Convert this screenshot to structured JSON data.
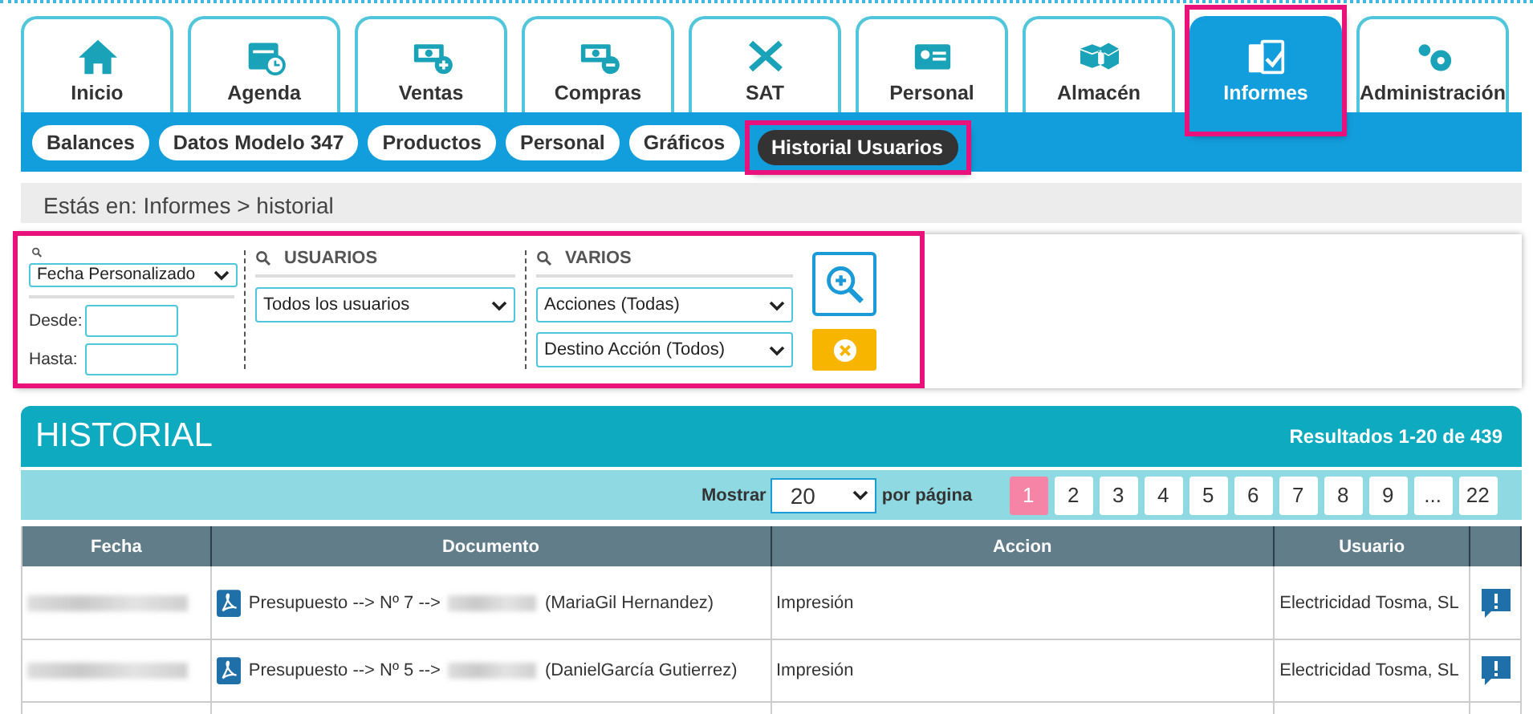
{
  "main_tabs": [
    {
      "label": "Inicio",
      "selected": false,
      "highlighted": false
    },
    {
      "label": "Agenda",
      "selected": false,
      "highlighted": false
    },
    {
      "label": "Ventas",
      "selected": false,
      "highlighted": false
    },
    {
      "label": "Compras",
      "selected": false,
      "highlighted": false
    },
    {
      "label": "SAT",
      "selected": false,
      "highlighted": false
    },
    {
      "label": "Personal",
      "selected": false,
      "highlighted": false
    },
    {
      "label": "Almacén",
      "selected": false,
      "highlighted": false
    },
    {
      "label": "Informes",
      "selected": true,
      "highlighted": true
    },
    {
      "label": "Administración",
      "selected": false,
      "highlighted": false
    }
  ],
  "sub_tabs": [
    {
      "label": "Balances",
      "selected": false,
      "highlighted": false
    },
    {
      "label": "Datos Modelo 347",
      "selected": false,
      "highlighted": false
    },
    {
      "label": "Productos",
      "selected": false,
      "highlighted": false
    },
    {
      "label": "Personal",
      "selected": false,
      "highlighted": false
    },
    {
      "label": "Gráficos",
      "selected": false,
      "highlighted": false
    },
    {
      "label": "Historial Usuarios",
      "selected": true,
      "highlighted": true
    }
  ],
  "breadcrumb": "Estás en: Informes > historial",
  "filters": {
    "highlighted": true,
    "date": {
      "select": "Fecha Personalizado",
      "from_label": "Desde:",
      "to_label": "Hasta:"
    },
    "users": {
      "heading": "USUARIOS",
      "select": "Todos los usuarios"
    },
    "misc": {
      "heading": "VARIOS",
      "selects": [
        "Acciones (Todas)",
        "Destino Acción (Todos)"
      ]
    }
  },
  "history": {
    "title": "HISTORIAL",
    "results": "Resultados 1-20 de 439",
    "show_label": "Mostrar",
    "per_page": "20",
    "per_page_label": "por página",
    "pages": [
      {
        "label": "1",
        "selected": true
      },
      {
        "label": "2",
        "selected": false
      },
      {
        "label": "3",
        "selected": false
      },
      {
        "label": "4",
        "selected": false
      },
      {
        "label": "5",
        "selected": false
      },
      {
        "label": "6",
        "selected": false
      },
      {
        "label": "7",
        "selected": false
      },
      {
        "label": "8",
        "selected": false
      },
      {
        "label": "9",
        "selected": false
      },
      {
        "label": "...",
        "selected": false
      },
      {
        "label": "22",
        "selected": false
      }
    ],
    "columns": [
      "Fecha",
      "Documento",
      "Accion",
      "Usuario"
    ],
    "rows": [
      {
        "doc_prefix": "Presupuesto --> Nº 7 -->",
        "doc_suffix": "(MariaGil Hernandez)",
        "action": "Impresión",
        "user": "Electricidad Tosma, SL"
      },
      {
        "doc_prefix": "Presupuesto --> Nº 5 -->",
        "doc_suffix": "(DanielGarcía Gutierrez)",
        "action": "Impresión",
        "user": "Electricidad Tosma, SL"
      }
    ]
  }
}
